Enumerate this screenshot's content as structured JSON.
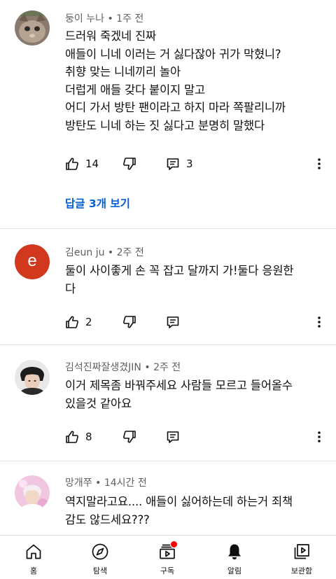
{
  "comments": [
    {
      "author": "둥이 누나",
      "time": "1주 전",
      "lines": [
        "드러워 죽겠네 진짜",
        "애들이 니네 이러는 거 싫다잖아 귀가 막혔니?",
        "취향 맞는 니네끼리 놀아",
        "더럽게 애들 갖다 붙이지 말고",
        "어디 가서 방탄 팬이라고 하지 마라 쪽팔리니까",
        "방탄도 니네 하는 짓 싫다고 분명히 말했다"
      ],
      "likes": "14",
      "reply_count": "3",
      "view_replies": "답글 3개 보기"
    },
    {
      "author": "김eun ju",
      "time": "2주 전",
      "avatar_letter": "e",
      "lines": [
        "둘이 사이좋게 손 꼭 잡고 달까지 가!둘다 응원한",
        "다"
      ],
      "likes": "2"
    },
    {
      "author": "김석진짜잘생겼JIN",
      "time": "2주 전",
      "lines": [
        "이거 제목좀 바꿔주세요 사람들 모르고 들어올수",
        "있을것 같아요"
      ],
      "likes": "8"
    },
    {
      "author": "망개쭈",
      "time": "14시간 전",
      "lines": [
        "역지말라고요.... 애들이 싫어하는데 하는거 죄책",
        "감도 않드세요???"
      ]
    }
  ],
  "meta_separator": "•",
  "nav": {
    "home": "홈",
    "explore": "탐색",
    "subscriptions": "구독",
    "notifications": "알림",
    "library": "보관함"
  },
  "colors": {
    "link_blue": "#065fd4",
    "avatar_red": "#d2381d",
    "badge_red": "#ff0000",
    "meta_gray": "#606060"
  }
}
